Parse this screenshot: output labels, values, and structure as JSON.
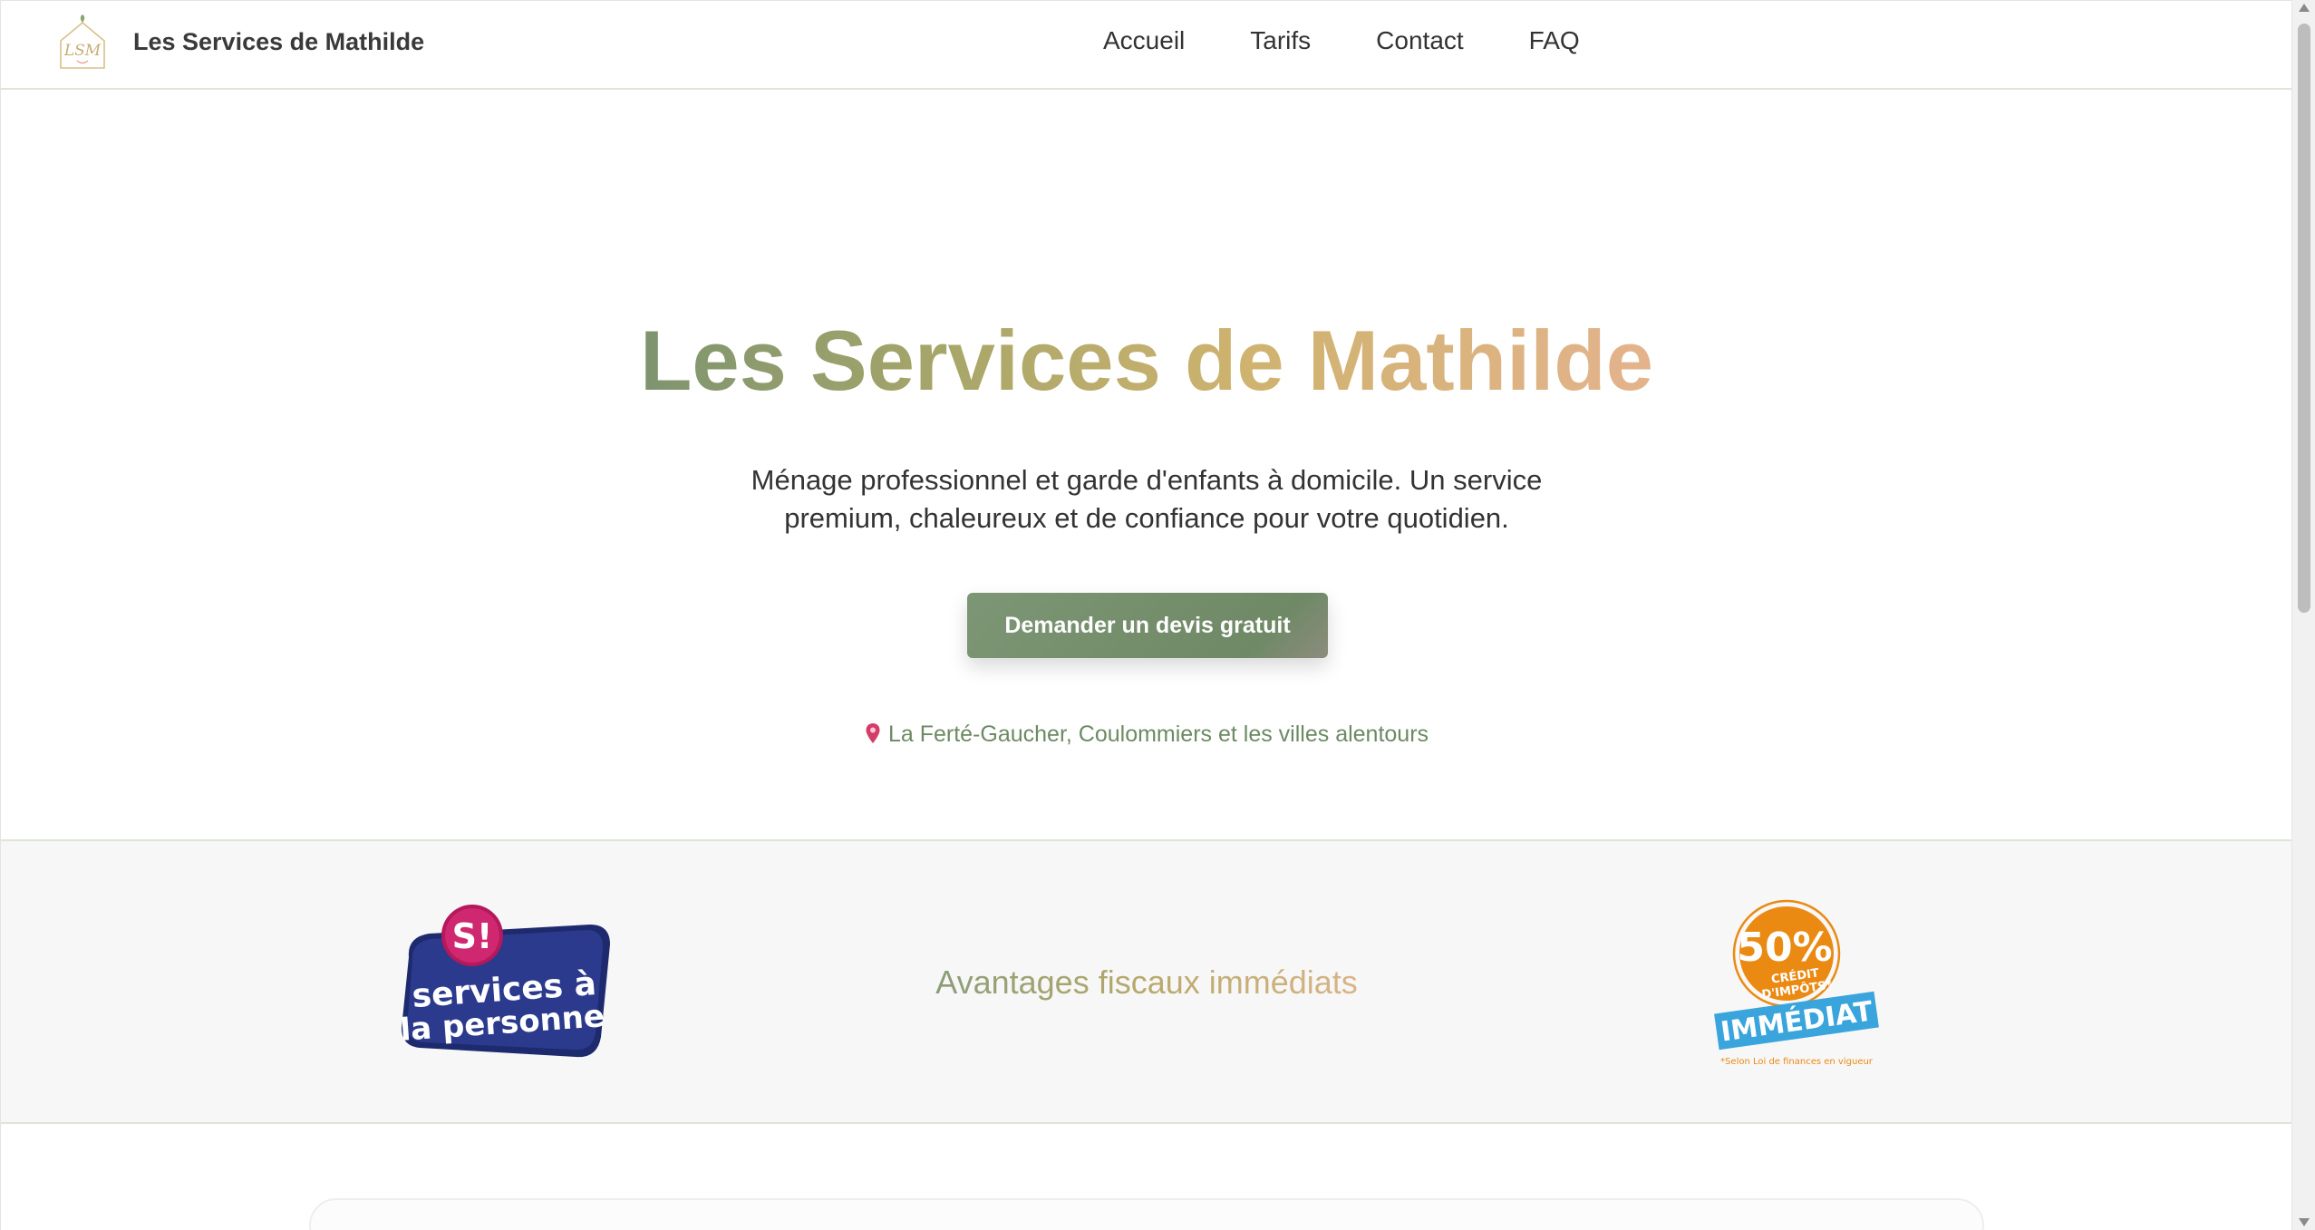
{
  "header": {
    "brand": "Les Services de Mathilde",
    "logo_initials": "LSM",
    "nav": [
      "Accueil",
      "Tarifs",
      "Contact",
      "FAQ"
    ]
  },
  "hero": {
    "title": "Les Services de Mathilde",
    "subtitle": "Ménage professionnel et garde d'enfants à domicile. Un service premium, chaleureux et de confiance pour votre quotidien.",
    "cta_label": "Demander un devis gratuit",
    "location": "La Ferté-Gaucher, Coulommiers et les villes alentours"
  },
  "band": {
    "title": "Avantages fiscaux immédiats",
    "sap_logo": {
      "badge": "S!",
      "line1": "services à",
      "line2": "la personne"
    },
    "credit_badge": {
      "percent": "50%",
      "line1": "CRÉDIT",
      "line2": "D'IMPÔTS*",
      "ribbon": "IMMÉDIAT",
      "note": "*Selon Loi de finances en vigueur"
    }
  },
  "colors": {
    "sage": "#7d9675",
    "gold": "#cfb36f",
    "peach": "#e4b38d",
    "location_text": "#6c8a63",
    "pin": "#d43c6a",
    "sap_navy": "#1e2a6e",
    "sap_magenta": "#b5185b",
    "credit_orange": "#ea8a12",
    "credit_blue": "#3aa5dc"
  },
  "icons": {
    "logo": "house-lsm-logo-icon",
    "location": "map-pin-icon"
  }
}
